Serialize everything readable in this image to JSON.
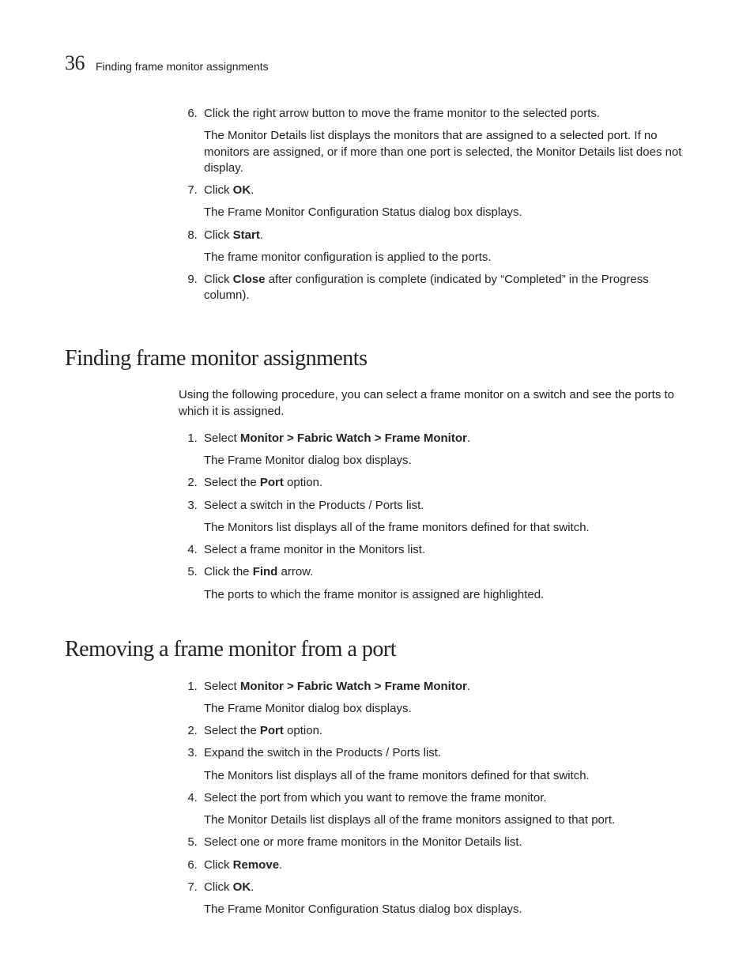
{
  "header": {
    "pageNumber": "36",
    "runningTitle": "Finding frame monitor assignments"
  },
  "topSteps": {
    "start": 6,
    "items": [
      {
        "text": "Click the right arrow button to move the frame monitor to the selected ports.",
        "sub": "The Monitor Details list displays the monitors that are assigned to a selected port. If no monitors are assigned, or if more than one port is selected, the Monitor Details list does not display."
      },
      {
        "pre": "Click ",
        "bold": "OK",
        "post": ".",
        "sub": "The Frame Monitor Configuration Status dialog box displays."
      },
      {
        "pre": "Click ",
        "bold": "Start",
        "post": ".",
        "sub": "The frame monitor configuration is applied to the ports."
      },
      {
        "pre": "Click ",
        "bold": "Close",
        "post": " after configuration is complete (indicated by “Completed” in the Progress column)."
      }
    ]
  },
  "section1": {
    "heading": "Finding frame monitor assignments",
    "intro": "Using the following procedure, you can select a frame monitor on a switch and see the ports to which it is assigned.",
    "items": [
      {
        "pre": "Select ",
        "bold": "Monitor > Fabric Watch > Frame Monitor",
        "post": ".",
        "sub": "The Frame Monitor dialog box displays."
      },
      {
        "pre": "Select the ",
        "bold": "Port",
        "post": " option."
      },
      {
        "text": "Select a switch in the Products / Ports list.",
        "sub": "The Monitors list displays all of the frame monitors defined for that switch."
      },
      {
        "text": "Select a frame monitor in the Monitors list."
      },
      {
        "pre": "Click the ",
        "bold": "Find",
        "post": " arrow.",
        "sub": "The ports to which the frame monitor is assigned are highlighted."
      }
    ]
  },
  "section2": {
    "heading": "Removing a frame monitor from a port",
    "items": [
      {
        "pre": "Select ",
        "bold": "Monitor > Fabric Watch > Frame Monitor",
        "post": ".",
        "sub": "The Frame Monitor dialog box displays."
      },
      {
        "pre": "Select the ",
        "bold": "Port",
        "post": " option."
      },
      {
        "text": "Expand the switch in the Products / Ports list.",
        "sub": "The Monitors list displays all of the frame monitors defined for that switch."
      },
      {
        "text": "Select the port from which you want to remove the frame monitor.",
        "sub": "The Monitor Details list displays all of the frame monitors assigned to that port."
      },
      {
        "text": "Select one or more frame monitors in the Monitor Details list."
      },
      {
        "pre": "Click ",
        "bold": "Remove",
        "post": "."
      },
      {
        "pre": "Click ",
        "bold": "OK",
        "post": ".",
        "sub": "The Frame Monitor Configuration Status dialog box displays."
      }
    ]
  }
}
